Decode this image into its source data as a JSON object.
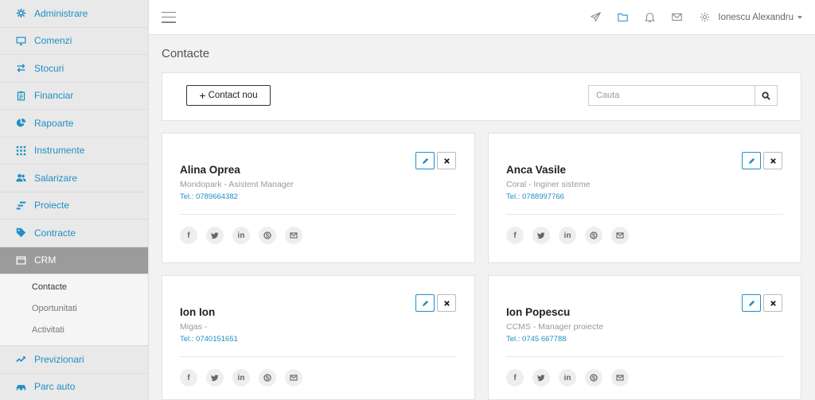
{
  "sidebar": {
    "items": [
      {
        "label": "Administrare",
        "icon": "gear-icon"
      },
      {
        "label": "Comenzi",
        "icon": "monitor-icon"
      },
      {
        "label": "Stocuri",
        "icon": "exchange-icon"
      },
      {
        "label": "Financiar",
        "icon": "clipboard-icon"
      },
      {
        "label": "Rapoarte",
        "icon": "pie-chart-icon"
      },
      {
        "label": "Instrumente",
        "icon": "grid-icon"
      },
      {
        "label": "Salarizare",
        "icon": "users-icon"
      },
      {
        "label": "Proiecte",
        "icon": "gantt-icon"
      },
      {
        "label": "Contracte",
        "icon": "tag-icon"
      },
      {
        "label": "CRM",
        "icon": "window-icon"
      }
    ],
    "crm_submenu": [
      "Contacte",
      "Oportunitati",
      "Activitati"
    ],
    "bottom_items": [
      {
        "label": "Previzionari",
        "icon": "trend-icon"
      },
      {
        "label": "Parc auto",
        "icon": "car-icon"
      }
    ]
  },
  "topbar": {
    "user_name": "Ionescu Alexandru"
  },
  "page": {
    "title": "Contacte"
  },
  "toolbar": {
    "add_label": "Contact nou",
    "search_placeholder": "Cauta"
  },
  "contacts": [
    {
      "name": "Alina Oprea",
      "company": "Mondopark - Asistent Manager",
      "tel": "Tel.: 0789664382"
    },
    {
      "name": "Anca Vasile",
      "company": "Coral - Inginer sisteme",
      "tel": "Tel.: 0788997766"
    },
    {
      "name": "Ion Ion",
      "company": "Migas -",
      "tel": "Tel.: 0740151651"
    },
    {
      "name": "Ion Popescu",
      "company": "CCMS - Manager proiecte",
      "tel": "Tel.: 0745 667788"
    }
  ],
  "colors": {
    "accent": "#1f8fc4",
    "sidebar_bg": "#e9e9e9",
    "active_bg": "#9b9b9b"
  }
}
